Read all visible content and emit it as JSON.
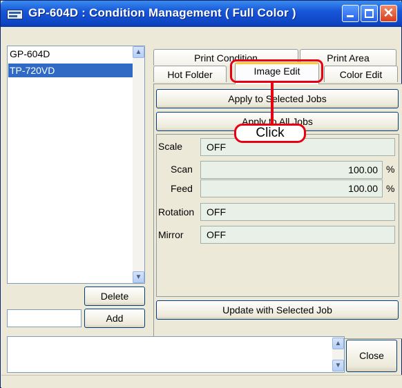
{
  "window": {
    "title": "GP-604D : Condition Management ( Full Color )",
    "min_glyph": "",
    "max_glyph": "",
    "close_glyph": "✕"
  },
  "printer_list": {
    "items": [
      "GP-604D",
      "TP-720VD"
    ],
    "selected": "TP-720VD",
    "scroll_up": "▲",
    "scroll_down": "▼"
  },
  "left_buttons": {
    "delete_label": "Delete",
    "add_label": "Add",
    "add_input_value": ""
  },
  "tabs": {
    "print_condition": "Print Condition",
    "print_area": "Print Area",
    "hot_folder": "Hot Folder",
    "image_edit": "Image Edit",
    "color_edit": "Color Edit",
    "active": "Image Edit"
  },
  "actions": {
    "apply_selected": "Apply to Selected Jobs",
    "apply_all": "Apply to All Jobs",
    "update_selected": "Update with Selected Job"
  },
  "image_edit": {
    "scale_label": "Scale",
    "scale_value": "OFF",
    "scan_label": "Scan",
    "scan_value": "100.00",
    "scan_unit": "%",
    "feed_label": "Feed",
    "feed_value": "100.00",
    "feed_unit": "%",
    "rotation_label": "Rotation",
    "rotation_value": "OFF",
    "mirror_label": "Mirror",
    "mirror_value": "OFF"
  },
  "bottom": {
    "message": "",
    "close_label": "Close",
    "scroll_up": "▲",
    "scroll_down": "▼"
  },
  "annotation": {
    "label": "Click",
    "color": "#e60012"
  }
}
